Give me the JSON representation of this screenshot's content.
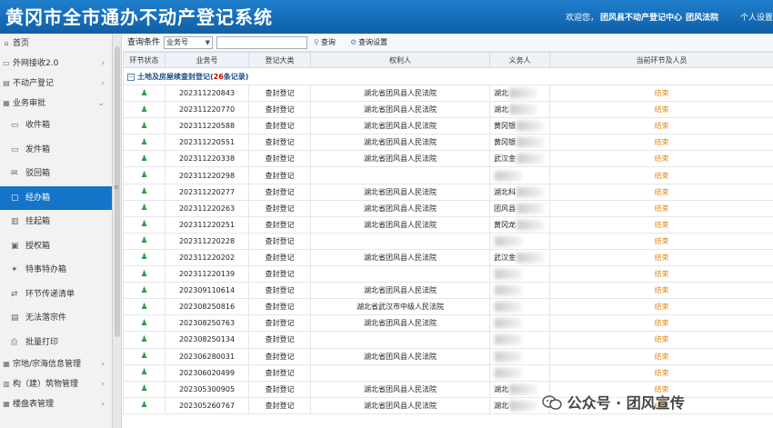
{
  "header": {
    "title": "黄冈市全市通办不动产登记系统",
    "welcome_prefix": "欢迎您，",
    "unit": "团风县不动产登记中心",
    "court": "团风法院",
    "settings": "个人设置"
  },
  "sidebar": {
    "items": [
      {
        "label": "首页",
        "icon": "home-icon"
      },
      {
        "label": "外网接收2.0",
        "icon": "inbox-icon",
        "chevron": "›"
      },
      {
        "label": "不动产登记",
        "icon": "register-icon",
        "chevron": "›"
      },
      {
        "label": "业务审批",
        "icon": "approve-icon",
        "chevron": "⌄"
      }
    ],
    "sub_items": [
      {
        "label": "收件箱",
        "icon": "inbox-icon"
      },
      {
        "label": "发件箱",
        "icon": "outbox-icon"
      },
      {
        "label": "驳回箱",
        "icon": "mail-icon"
      },
      {
        "label": "经办箱",
        "icon": "folder-icon",
        "active": true
      },
      {
        "label": "挂起箱",
        "icon": "pause-icon"
      },
      {
        "label": "授权箱",
        "icon": "authorize-icon"
      },
      {
        "label": "特事特办箱",
        "icon": "star-icon"
      },
      {
        "label": "环节传递清单",
        "icon": "transfer-icon"
      },
      {
        "label": "无法落宗件",
        "icon": "document-icon"
      },
      {
        "label": "批量打印",
        "icon": "print-icon"
      }
    ],
    "bottom_items": [
      {
        "label": "宗地/宗海信息管理",
        "icon": "land-icon",
        "chevron": "›"
      },
      {
        "label": "构（建）筑物管理",
        "icon": "building-icon",
        "chevron": "›"
      },
      {
        "label": "楼盘表管理",
        "icon": "table-icon",
        "chevron": "›"
      }
    ]
  },
  "toolbar": {
    "query_label": "查询条件",
    "select_value": "业务号",
    "search_value": "",
    "query_button": "查询",
    "settings_button": "查询设置"
  },
  "table": {
    "headers": [
      "环节状态",
      "业务号",
      "登记大类",
      "权利人",
      "义务人",
      "当前环节及人员"
    ],
    "group": {
      "name": "土地及房屋续查封登记",
      "count": "26",
      "count_suffix": "条记录",
      "open": "(",
      "close": ")"
    },
    "status_icon": "person-icon",
    "rows": [
      {
        "id": "202311220843",
        "type": "查封登记",
        "holder": "湖北省团风县人民法院",
        "obligor": "湖北",
        "stage": "结束"
      },
      {
        "id": "202311220770",
        "type": "查封登记",
        "holder": "湖北省团风县人民法院",
        "obligor": "湖北",
        "stage": "结束"
      },
      {
        "id": "202311220588",
        "type": "查封登记",
        "holder": "湖北省团风县人民法院",
        "obligor": "黄冈银",
        "stage": "结束"
      },
      {
        "id": "202311220551",
        "type": "查封登记",
        "holder": "湖北省团风县人民法院",
        "obligor": "黄冈银",
        "stage": "结束"
      },
      {
        "id": "202311220338",
        "type": "查封登记",
        "holder": "湖北省团风县人民法院",
        "obligor": "武汉金",
        "stage": "结束"
      },
      {
        "id": "202311220298",
        "type": "查封登记",
        "holder": "",
        "obligor": "",
        "stage": "结束"
      },
      {
        "id": "202311220277",
        "type": "查封登记",
        "holder": "湖北省团风县人民法院",
        "obligor": "湖北科",
        "stage": "结束"
      },
      {
        "id": "202311220263",
        "type": "查封登记",
        "holder": "湖北省团风县人民法院",
        "obligor": "团风县",
        "stage": "结束"
      },
      {
        "id": "202311220251",
        "type": "查封登记",
        "holder": "湖北省团风县人民法院",
        "obligor": "黄冈龙",
        "stage": "结束"
      },
      {
        "id": "202311220228",
        "type": "查封登记",
        "holder": "",
        "obligor": "",
        "stage": "结束"
      },
      {
        "id": "202311220202",
        "type": "查封登记",
        "holder": "湖北省团风县人民法院",
        "obligor": "武汉金",
        "stage": "结束"
      },
      {
        "id": "202311220139",
        "type": "查封登记",
        "holder": "",
        "obligor": "",
        "stage": "结束"
      },
      {
        "id": "202309110614",
        "type": "查封登记",
        "holder": "湖北省团风县人民法院",
        "obligor": "",
        "stage": "结束"
      },
      {
        "id": "202308250816",
        "type": "查封登记",
        "holder": "湖北省武汉市中级人民法院",
        "obligor": "",
        "stage": "结束"
      },
      {
        "id": "202308250763",
        "type": "查封登记",
        "holder": "湖北省团风县人民法院",
        "obligor": "",
        "stage": "结束"
      },
      {
        "id": "202308250134",
        "type": "查封登记",
        "holder": "",
        "obligor": "",
        "stage": "结束"
      },
      {
        "id": "202306280031",
        "type": "查封登记",
        "holder": "湖北省团风县人民法院",
        "obligor": "",
        "stage": "结束"
      },
      {
        "id": "202306020499",
        "type": "查封登记",
        "holder": "",
        "obligor": "",
        "stage": "结束"
      },
      {
        "id": "202305300905",
        "type": "查封登记",
        "holder": "湖北省团风县人民法院",
        "obligor": "湖北",
        "stage": "结束"
      },
      {
        "id": "202305260767",
        "type": "查封登记",
        "holder": "湖北省团风县人民法院",
        "obligor": "湖北",
        "stage": "结束"
      }
    ]
  },
  "watermark": {
    "text": "公众号 · 团风宣传"
  },
  "colors": {
    "header": "#1670c0",
    "active": "#1474c8",
    "stage": "#e08a12",
    "count": "#c00000"
  }
}
